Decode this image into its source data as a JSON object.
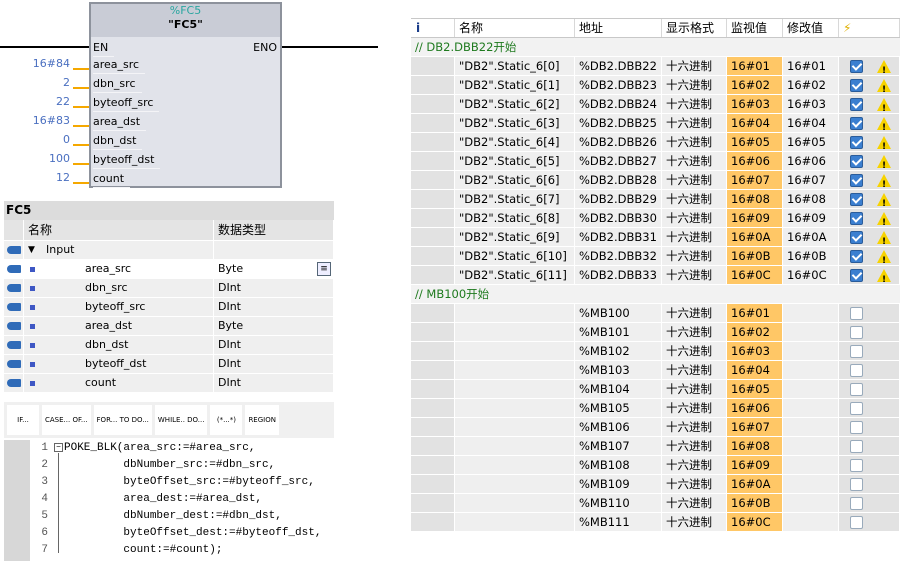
{
  "block": {
    "instance": "%FC5",
    "name": "\"FC5\"",
    "en": "EN",
    "eno": "ENO",
    "pins": [
      {
        "name": "area_src",
        "value": "16#84"
      },
      {
        "name": "dbn_src",
        "value": "2"
      },
      {
        "name": "byteoff_src",
        "value": "22"
      },
      {
        "name": "area_dst",
        "value": "16#83"
      },
      {
        "name": "dbn_dst",
        "value": "0"
      },
      {
        "name": "byteoff_dst",
        "value": "100"
      },
      {
        "name": "count",
        "value": "12"
      }
    ]
  },
  "interface": {
    "title": "FC5",
    "col_name": "名称",
    "col_type": "数据类型",
    "section": "Input",
    "rows": [
      {
        "name": "area_src",
        "type": "Byte"
      },
      {
        "name": "dbn_src",
        "type": "DInt"
      },
      {
        "name": "byteoff_src",
        "type": "DInt"
      },
      {
        "name": "area_dst",
        "type": "Byte"
      },
      {
        "name": "dbn_dst",
        "type": "DInt"
      },
      {
        "name": "byteoff_dst",
        "type": "DInt"
      },
      {
        "name": "count",
        "type": "DInt"
      }
    ]
  },
  "toolbar": [
    "IF...",
    "CASE... OF...",
    "FOR... TO DO...",
    "WHILE.. DO...",
    "(*...*)",
    "REGION"
  ],
  "code": [
    "POKE_BLK(area_src:=#area_src,",
    "         dbNumber_src:=#dbn_src,",
    "         byteOffset_src:=#byteoff_src,",
    "         area_dest:=#area_dst,",
    "         dbNumber_dest:=#dbn_dst,",
    "         byteOffset_dest:=#byteoff_dst,",
    "         count:=#count);"
  ],
  "watch": {
    "headers": [
      "i",
      "名称",
      "地址",
      "显示格式",
      "监视值",
      "修改值",
      "⚡"
    ],
    "comment1": "// DB2.DBB22开始",
    "comment2": "// MB100开始",
    "db_rows": [
      [
        "\"DB2\".Static_6[0]",
        "%DB2.DBB22",
        "十六进制",
        "16#01",
        "16#01"
      ],
      [
        "\"DB2\".Static_6[1]",
        "%DB2.DBB23",
        "十六进制",
        "16#02",
        "16#02"
      ],
      [
        "\"DB2\".Static_6[2]",
        "%DB2.DBB24",
        "十六进制",
        "16#03",
        "16#03"
      ],
      [
        "\"DB2\".Static_6[3]",
        "%DB2.DBB25",
        "十六进制",
        "16#04",
        "16#04"
      ],
      [
        "\"DB2\".Static_6[4]",
        "%DB2.DBB26",
        "十六进制",
        "16#05",
        "16#05"
      ],
      [
        "\"DB2\".Static_6[5]",
        "%DB2.DBB27",
        "十六进制",
        "16#06",
        "16#06"
      ],
      [
        "\"DB2\".Static_6[6]",
        "%DB2.DBB28",
        "十六进制",
        "16#07",
        "16#07"
      ],
      [
        "\"DB2\".Static_6[7]",
        "%DB2.DBB29",
        "十六进制",
        "16#08",
        "16#08"
      ],
      [
        "\"DB2\".Static_6[8]",
        "%DB2.DBB30",
        "十六进制",
        "16#09",
        "16#09"
      ],
      [
        "\"DB2\".Static_6[9]",
        "%DB2.DBB31",
        "十六进制",
        "16#0A",
        "16#0A"
      ],
      [
        "\"DB2\".Static_6[10]",
        "%DB2.DBB32",
        "十六进制",
        "16#0B",
        "16#0B"
      ],
      [
        "\"DB2\".Static_6[11]",
        "%DB2.DBB33",
        "十六进制",
        "16#0C",
        "16#0C"
      ]
    ],
    "mb_rows": [
      [
        "",
        "%MB100",
        "十六进制",
        "16#01",
        ""
      ],
      [
        "",
        "%MB101",
        "十六进制",
        "16#02",
        ""
      ],
      [
        "",
        "%MB102",
        "十六进制",
        "16#03",
        ""
      ],
      [
        "",
        "%MB103",
        "十六进制",
        "16#04",
        ""
      ],
      [
        "",
        "%MB104",
        "十六进制",
        "16#05",
        ""
      ],
      [
        "",
        "%MB105",
        "十六进制",
        "16#06",
        ""
      ],
      [
        "",
        "%MB106",
        "十六进制",
        "16#07",
        ""
      ],
      [
        "",
        "%MB107",
        "十六进制",
        "16#08",
        ""
      ],
      [
        "",
        "%MB108",
        "十六进制",
        "16#09",
        ""
      ],
      [
        "",
        "%MB109",
        "十六进制",
        "16#0A",
        ""
      ],
      [
        "",
        "%MB110",
        "十六进制",
        "16#0B",
        ""
      ],
      [
        "",
        "%MB111",
        "十六进制",
        "16#0C",
        ""
      ]
    ]
  }
}
